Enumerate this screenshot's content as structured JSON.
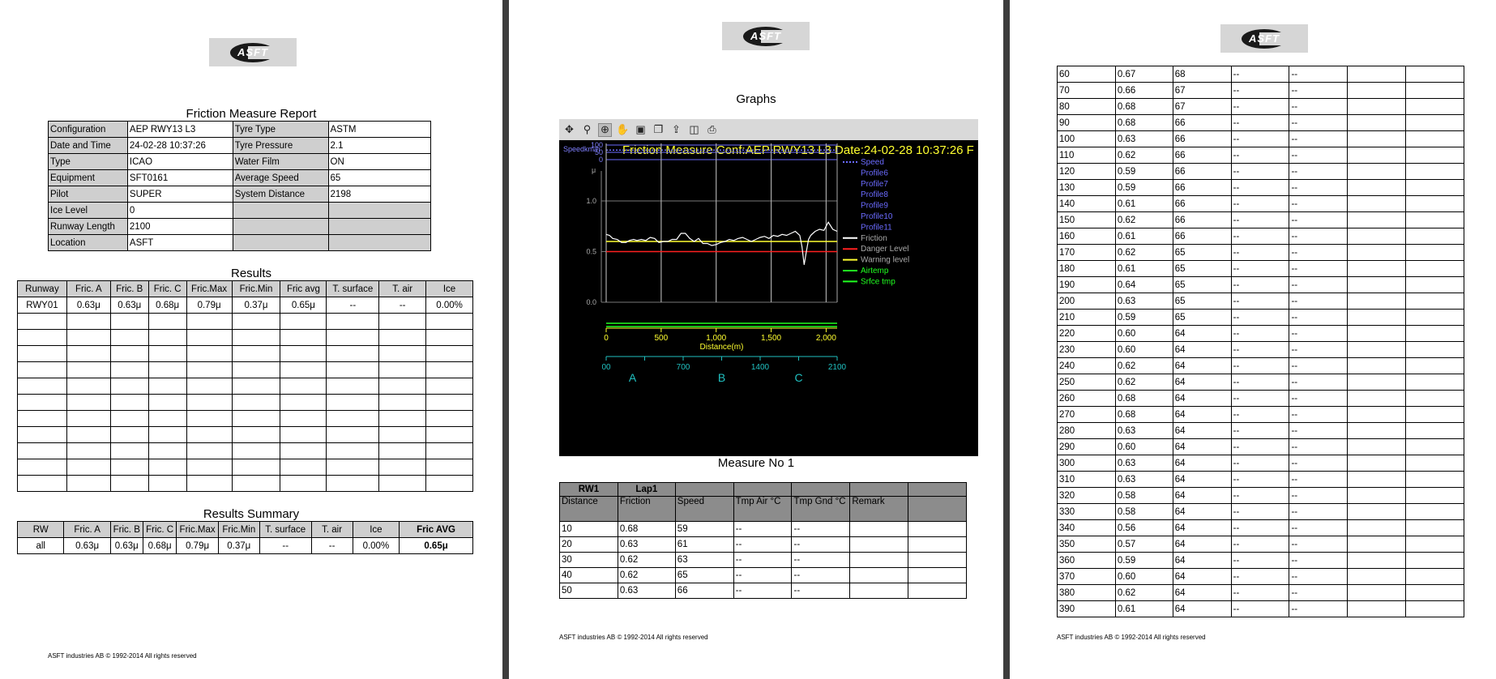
{
  "logo": {
    "text": "ASFT"
  },
  "page1": {
    "title": "Friction Measure Report",
    "info_rows": [
      [
        "Configuration",
        "AEP RWY13 L3",
        "Tyre Type",
        "ASTM"
      ],
      [
        "Date and Time",
        "24-02-28 10:37:26",
        "Tyre Pressure",
        "2.1"
      ],
      [
        "Type",
        "ICAO",
        "Water Film",
        "ON"
      ],
      [
        "Equipment",
        "SFT0161",
        "Average Speed",
        "65"
      ],
      [
        "Pilot",
        "SUPER",
        "System Distance",
        "2198"
      ],
      [
        "Ice Level",
        "0",
        "",
        ""
      ],
      [
        "Runway Length",
        "2100",
        "",
        ""
      ],
      [
        "Location",
        "ASFT",
        "",
        ""
      ]
    ],
    "results_title": "Results",
    "results_headers": [
      "Runway",
      "Fric. A",
      "Fric. B",
      "Fric. C",
      "Fric.Max",
      "Fric.Min",
      "Fric avg",
      "T. surface",
      "T. air",
      "Ice"
    ],
    "results_rows": [
      [
        "RWY01",
        "0.63μ",
        "0.63μ",
        "0.68μ",
        "0.79μ",
        "0.37μ",
        "0.65μ",
        "--",
        "--",
        "0.00%"
      ]
    ],
    "summary_title": "Results Summary",
    "summary_headers": [
      "RW",
      "Fric. A",
      "Fric. B",
      "Fric. C",
      "Fric.Max",
      "Fric.Min",
      "T. surface",
      "T. air",
      "Ice",
      "Fric AVG"
    ],
    "summary_rows": [
      [
        "all",
        "0.63μ",
        "0.63μ",
        "0.68μ",
        "0.79μ",
        "0.37μ",
        "--",
        "--",
        "0.00%",
        "0.65μ"
      ]
    ],
    "footer": "ASFT industries AB © 1992-2014 All rights reserved"
  },
  "page2": {
    "title": "Graphs",
    "toolbar_icons": [
      "move-icon",
      "zoom-icon",
      "zoom-in-icon",
      "pan-icon",
      "save-icon",
      "copy-icon",
      "export-icon",
      "print-preview-icon",
      "print-icon"
    ],
    "graph_title": "Friction Measure Conf:AEP RWY13 L3 Date:24-02-28 10:37:26 F",
    "speed_label": "Speedkm/h",
    "mu_label": "μ",
    "speed_ticks": [
      "100",
      "50",
      "0"
    ],
    "friction_ticks": [
      "1.0",
      "0.5",
      "0.0"
    ],
    "distance_ticks": [
      "0",
      "500",
      "1,000",
      "1,500",
      "2,000"
    ],
    "distance_label": "Distance(m)",
    "section_ticks": [
      "00",
      "700",
      "1400",
      "2100"
    ],
    "section_letters": [
      "A",
      "B",
      "C"
    ],
    "legend": [
      {
        "name": "Speed",
        "color": "#6b6bff",
        "style": "dotted"
      },
      {
        "name": "Profile6",
        "color": "#6b6bff",
        "style": "none"
      },
      {
        "name": "Profile7",
        "color": "#6b6bff",
        "style": "none"
      },
      {
        "name": "Profile8",
        "color": "#6b6bff",
        "style": "none"
      },
      {
        "name": "Profile9",
        "color": "#6b6bff",
        "style": "none"
      },
      {
        "name": "Profile10",
        "color": "#6b6bff",
        "style": "none"
      },
      {
        "name": "Profile11",
        "color": "#6b6bff",
        "style": "none"
      },
      {
        "name": "Friction",
        "color": "#ffffff",
        "style": "solid"
      },
      {
        "name": "Danger Level",
        "color": "#ff2020",
        "style": "solid"
      },
      {
        "name": "Warning level",
        "color": "#ffff30",
        "style": "solid"
      },
      {
        "name": "Airtemp",
        "color": "#20ff20",
        "style": "solid"
      },
      {
        "name": "Srfce tmp",
        "color": "#20ff20",
        "style": "solid"
      }
    ],
    "chart_data": {
      "type": "line",
      "title": "Friction Measure Conf:AEP RWY13 L3 Date:24-02-28 10:37:26 F",
      "xlabel": "Distance(m)",
      "ylabel": "μ",
      "xlim": [
        0,
        2100
      ],
      "ylim": [
        0,
        1.2
      ],
      "speed_ylim": [
        0,
        100
      ],
      "danger_level": 0.5,
      "warning_level": 0.6,
      "grid": true,
      "legend_position": "right",
      "friction": {
        "x": [
          0,
          30,
          60,
          100,
          140,
          180,
          210,
          250,
          280,
          320,
          360,
          400,
          440,
          480,
          520,
          560,
          600,
          640,
          680,
          720,
          760,
          800,
          840,
          880,
          920,
          960,
          1000,
          1040,
          1080,
          1120,
          1160,
          1200,
          1240,
          1280,
          1320,
          1360,
          1400,
          1440,
          1480,
          1520,
          1560,
          1600,
          1640,
          1680,
          1720,
          1760,
          1780,
          1800,
          1820,
          1840,
          1860,
          1880,
          1900,
          1940,
          1980,
          2020,
          2060,
          2100
        ],
        "y": [
          0.67,
          0.66,
          0.63,
          0.62,
          0.59,
          0.59,
          0.61,
          0.62,
          0.61,
          0.62,
          0.61,
          0.64,
          0.63,
          0.59,
          0.6,
          0.6,
          0.62,
          0.62,
          0.68,
          0.68,
          0.63,
          0.6,
          0.63,
          0.58,
          0.58,
          0.56,
          0.57,
          0.59,
          0.6,
          0.62,
          0.61,
          0.63,
          0.64,
          0.62,
          0.6,
          0.62,
          0.64,
          0.65,
          0.63,
          0.66,
          0.65,
          0.67,
          0.66,
          0.68,
          0.7,
          0.66,
          0.55,
          0.37,
          0.5,
          0.62,
          0.66,
          0.68,
          0.7,
          0.72,
          0.71,
          0.79,
          0.72,
          0.7
        ]
      },
      "speed": {
        "x": [
          0,
          2100
        ],
        "y": [
          65,
          65
        ]
      }
    },
    "caption": "Measure No 1",
    "table_head1": [
      "RW1",
      "Lap1",
      "",
      "",
      "",
      "",
      ""
    ],
    "table_head2": [
      "Distance",
      "Friction",
      "Speed",
      "Tmp Air °C",
      "Tmp Gnd °C",
      "Remark",
      ""
    ],
    "rows": [
      [
        "10",
        "0.68",
        "59",
        "--",
        "--",
        "",
        ""
      ],
      [
        "20",
        "0.63",
        "61",
        "--",
        "--",
        "",
        ""
      ],
      [
        "30",
        "0.62",
        "63",
        "--",
        "--",
        "",
        ""
      ],
      [
        "40",
        "0.62",
        "65",
        "--",
        "--",
        "",
        ""
      ],
      [
        "50",
        "0.63",
        "66",
        "--",
        "--",
        "",
        ""
      ]
    ],
    "footer": "ASFT industries AB © 1992-2014 All rights reserved"
  },
  "page3": {
    "rows": [
      [
        "60",
        "0.67",
        "68",
        "--",
        "--",
        "",
        ""
      ],
      [
        "70",
        "0.66",
        "67",
        "--",
        "--",
        "",
        ""
      ],
      [
        "80",
        "0.68",
        "67",
        "--",
        "--",
        "",
        ""
      ],
      [
        "90",
        "0.68",
        "66",
        "--",
        "--",
        "",
        ""
      ],
      [
        "100",
        "0.63",
        "66",
        "--",
        "--",
        "",
        ""
      ],
      [
        "110",
        "0.62",
        "66",
        "--",
        "--",
        "",
        ""
      ],
      [
        "120",
        "0.59",
        "66",
        "--",
        "--",
        "",
        ""
      ],
      [
        "130",
        "0.59",
        "66",
        "--",
        "--",
        "",
        ""
      ],
      [
        "140",
        "0.61",
        "66",
        "--",
        "--",
        "",
        ""
      ],
      [
        "150",
        "0.62",
        "66",
        "--",
        "--",
        "",
        ""
      ],
      [
        "160",
        "0.61",
        "66",
        "--",
        "--",
        "",
        ""
      ],
      [
        "170",
        "0.62",
        "65",
        "--",
        "--",
        "",
        ""
      ],
      [
        "180",
        "0.61",
        "65",
        "--",
        "--",
        "",
        ""
      ],
      [
        "190",
        "0.64",
        "65",
        "--",
        "--",
        "",
        ""
      ],
      [
        "200",
        "0.63",
        "65",
        "--",
        "--",
        "",
        ""
      ],
      [
        "210",
        "0.59",
        "65",
        "--",
        "--",
        "",
        ""
      ],
      [
        "220",
        "0.60",
        "64",
        "--",
        "--",
        "",
        ""
      ],
      [
        "230",
        "0.60",
        "64",
        "--",
        "--",
        "",
        ""
      ],
      [
        "240",
        "0.62",
        "64",
        "--",
        "--",
        "",
        ""
      ],
      [
        "250",
        "0.62",
        "64",
        "--",
        "--",
        "",
        ""
      ],
      [
        "260",
        "0.68",
        "64",
        "--",
        "--",
        "",
        ""
      ],
      [
        "270",
        "0.68",
        "64",
        "--",
        "--",
        "",
        ""
      ],
      [
        "280",
        "0.63",
        "64",
        "--",
        "--",
        "",
        ""
      ],
      [
        "290",
        "0.60",
        "64",
        "--",
        "--",
        "",
        ""
      ],
      [
        "300",
        "0.63",
        "64",
        "--",
        "--",
        "",
        ""
      ],
      [
        "310",
        "0.63",
        "64",
        "--",
        "--",
        "",
        ""
      ],
      [
        "320",
        "0.58",
        "64",
        "--",
        "--",
        "",
        ""
      ],
      [
        "330",
        "0.58",
        "64",
        "--",
        "--",
        "",
        ""
      ],
      [
        "340",
        "0.56",
        "64",
        "--",
        "--",
        "",
        ""
      ],
      [
        "350",
        "0.57",
        "64",
        "--",
        "--",
        "",
        ""
      ],
      [
        "360",
        "0.59",
        "64",
        "--",
        "--",
        "",
        ""
      ],
      [
        "370",
        "0.60",
        "64",
        "--",
        "--",
        "",
        ""
      ],
      [
        "380",
        "0.62",
        "64",
        "--",
        "--",
        "",
        ""
      ],
      [
        "390",
        "0.61",
        "64",
        "--",
        "--",
        "",
        ""
      ]
    ],
    "footer": "ASFT industries AB © 1992-2014 All rights reserved"
  }
}
